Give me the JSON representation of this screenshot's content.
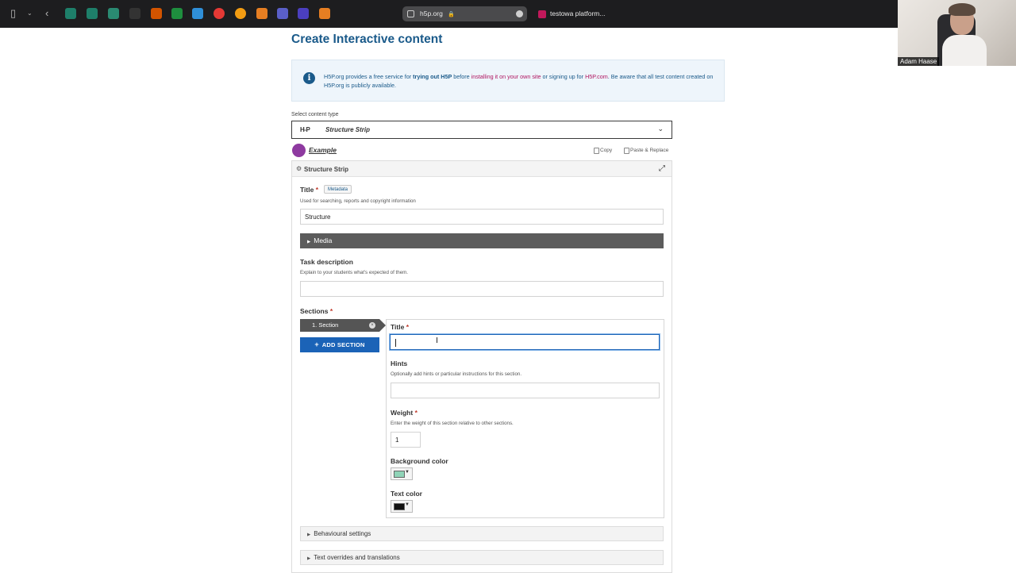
{
  "browser": {
    "address": "h5p.org",
    "tab2_title": "testowa platform...",
    "webcam_name": "Adam Haase"
  },
  "page": {
    "title": "Create Interactive content",
    "notice": {
      "part1": "H5P.org provides a free service for ",
      "bold1": "trying out H5P",
      "part2": " before ",
      "link1": "installing it on your own site",
      "part3": " or signing up for ",
      "link2": "H5P.com",
      "part4": ". Be aware that all test content created on H5P.org is publicly available."
    },
    "select_content_type_label": "Select content type",
    "content_type_logo": "H-P",
    "content_type": "Structure Strip",
    "example_label": "Example",
    "copy_label": "Copy",
    "paste_label": "Paste & Replace"
  },
  "editor": {
    "header_title": "Structure Strip",
    "title_label": "Title",
    "metadata_label": "Metadata",
    "title_desc": "Used for searching, reports and copyright information",
    "title_value": "Structure",
    "media_label": "Media",
    "task_label": "Task description",
    "task_desc": "Explain to your students what's expected of them.",
    "sections_label": "Sections",
    "section_tab": "1. Section",
    "add_section": "ADD SECTION",
    "section": {
      "title_label": "Title",
      "title_value": "",
      "hints_label": "Hints",
      "hints_desc": "Optionally add hints or particular instructions for this section.",
      "weight_label": "Weight",
      "weight_desc": "Enter the weight of this section relative to other sections.",
      "weight_value": "1",
      "bg_color_label": "Background color",
      "bg_color": "#8fd3b7",
      "text_color_label": "Text color",
      "text_color": "#111111"
    },
    "behavioural_label": "Behavioural settings",
    "overrides_label": "Text overrides and translations"
  },
  "colors": {
    "accent_blue": "#1b63b7",
    "title_blue": "#1a5a8a",
    "link_pink": "#b01560",
    "media_bar": "#5c5c5c"
  }
}
